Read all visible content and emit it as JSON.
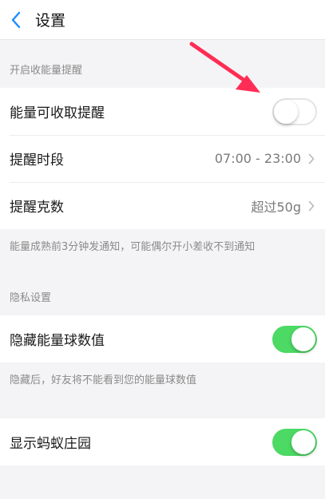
{
  "nav": {
    "back_icon": "chevron-left-icon",
    "title": "设置"
  },
  "energy_section": {
    "header": "开启收能量提醒",
    "rows": [
      {
        "label": "能量可收取提醒",
        "type": "toggle",
        "on": false
      },
      {
        "label": "提醒时段",
        "type": "link",
        "value": "07:00 - 23:00"
      },
      {
        "label": "提醒克数",
        "type": "link",
        "value": "超过50g"
      }
    ],
    "note": "能量成熟前3分钟发通知，可能偶尔开小差收不到通知"
  },
  "privacy_section": {
    "header": "隐私设置",
    "rows": [
      {
        "label": "隐藏能量球数值",
        "type": "toggle",
        "on": true
      }
    ],
    "note": "隐藏后，好友将不能看到您的能量球数值"
  },
  "manor_section": {
    "rows": [
      {
        "label": "显示蚂蚁庄园",
        "type": "toggle",
        "on": true
      }
    ]
  },
  "colors": {
    "accent": "#1a8cff",
    "toggle_on": "#4cd964",
    "annotation_arrow": "#ff2d55"
  }
}
